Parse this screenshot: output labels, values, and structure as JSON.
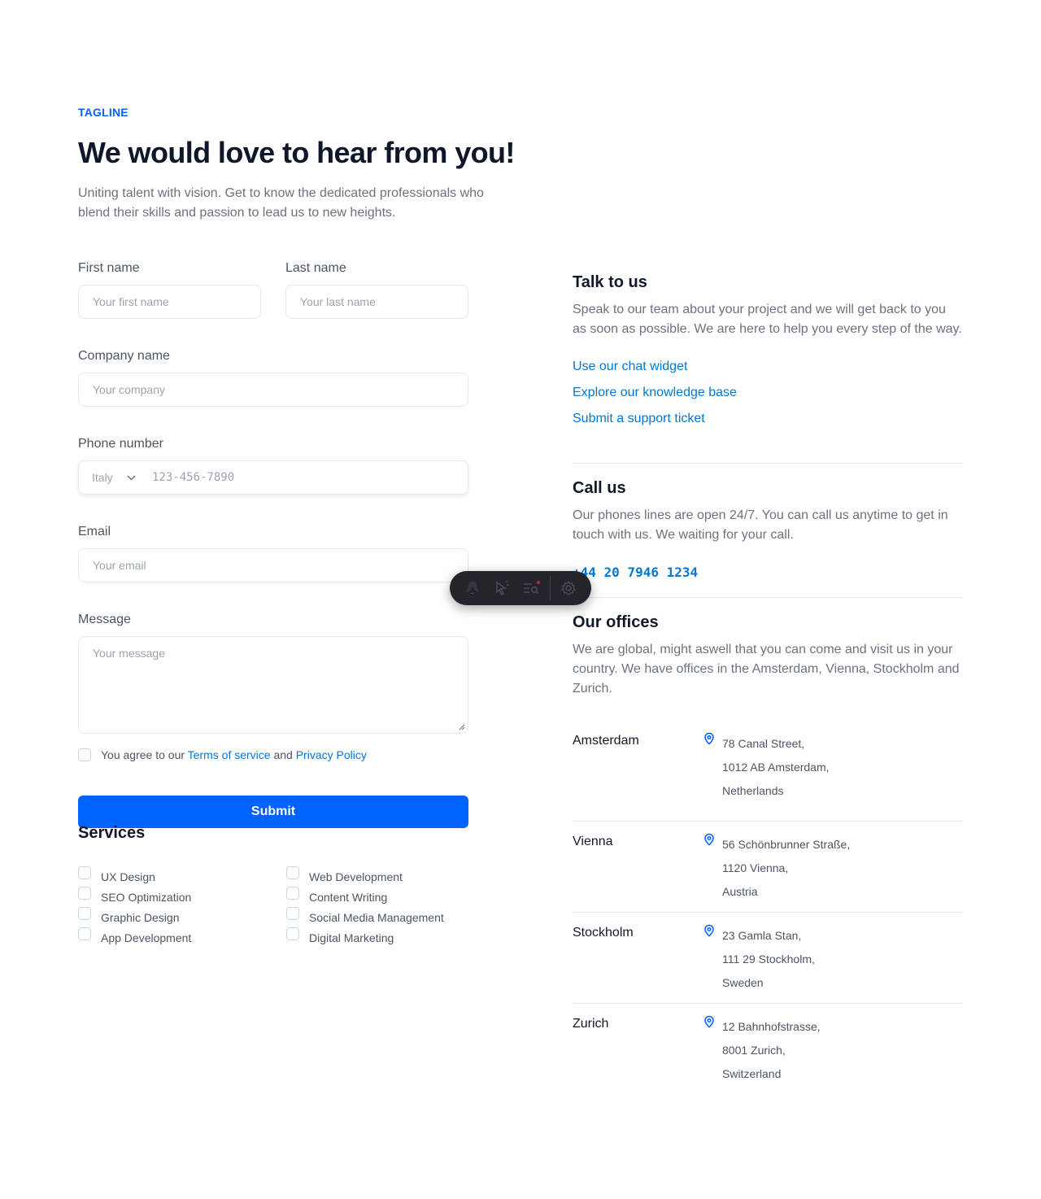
{
  "header": {
    "tagline": "TAGLINE",
    "title": "We would love to hear from you!",
    "subtitle": "Uniting talent with vision. Get to know the dedicated professionals who blend their skills and passion to lead us to new heights."
  },
  "form": {
    "first_name": {
      "label": "First name",
      "placeholder": "Your first name"
    },
    "last_name": {
      "label": "Last name",
      "placeholder": "Your last name"
    },
    "company": {
      "label": "Company name",
      "placeholder": "Your company"
    },
    "phone": {
      "label": "Phone number",
      "country": "Italy",
      "placeholder": "123-456-7890"
    },
    "email": {
      "label": "Email",
      "placeholder": "Your email"
    },
    "message": {
      "label": "Message",
      "placeholder": "Your message"
    },
    "agree": {
      "prefix": "You agree to our",
      "terms": "Terms of service",
      "and": "and",
      "privacy": "Privacy Policy"
    },
    "submit_label": "Submit"
  },
  "services": {
    "title": "Services",
    "items": [
      "UX Design",
      "Web Development",
      "SEO Optimization",
      "Content Writing",
      "Graphic Design",
      "Social Media Management",
      "App Development",
      "Digital Marketing"
    ]
  },
  "talk": {
    "title": "Talk to us",
    "text": "Speak to our team about your project and we will get back to you as soon as possible. We are here to help you every step of the way.",
    "links": [
      "Use our chat widget",
      "Explore our knowledge base",
      "Submit a support ticket"
    ]
  },
  "call": {
    "title": "Call us",
    "text": "Our phones lines are open 24/7. You can call us anytime to get in touch with us. We waiting for your call.",
    "phone": "+44 20 7946 1234"
  },
  "offices": {
    "title": "Our offices",
    "text": "We are global, might aswell that you can come and visit us in your country. We have offices in the Amsterdam, Vienna, Stockholm and Zurich.",
    "list": [
      {
        "city": "Amsterdam",
        "line1": "78 Canal Street,",
        "line2": "1012 AB Amsterdam,",
        "line3": "Netherlands"
      },
      {
        "city": "Vienna",
        "line1": "56 Schönbrunner Straße,",
        "line2": "1120 Vienna,",
        "line3": "Austria"
      },
      {
        "city": "Stockholm",
        "line1": "23 Gamla Stan,",
        "line2": "111 29 Stockholm,",
        "line3": "Sweden"
      },
      {
        "city": "Zurich",
        "line1": "12 Bahnhofstrasse,",
        "line2": "8001 Zurich,",
        "line3": "Switzerland"
      }
    ]
  },
  "toolbar": {
    "icons": [
      "astro-logo-icon",
      "inspect-cursor-icon",
      "audit-list-icon",
      "settings-gear-icon"
    ]
  },
  "colors": {
    "accent": "#0062ff",
    "link": "#0078d4",
    "text": "#111827",
    "muted": "#6b7280"
  }
}
